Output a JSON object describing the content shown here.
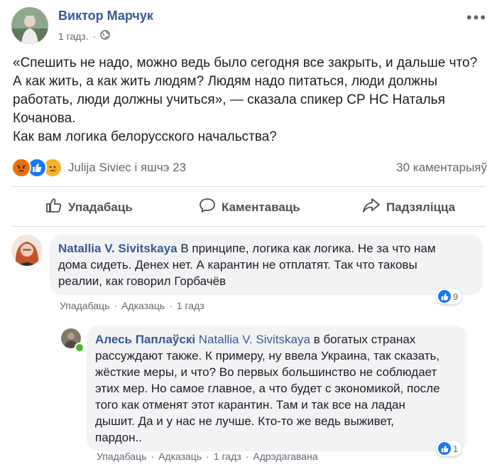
{
  "post": {
    "author": "Виктор Марчук",
    "time": "1 гадз.",
    "lines": [
      "«Спешить не надо, можно ведь было сегодня все закрыть, и дальше что?",
      "А как жить, а как жить людям? Людям надо питаться, люди должны",
      "работать, люди должны учиться», — сказала спикер СР НС Наталья",
      "Кочанова.",
      "Как вам логика белорусского начальства?"
    ]
  },
  "reactions": {
    "names": "Julija Siviec і яшчэ 23",
    "comments_count": "30 каментарыяў",
    "types": [
      "angry-icon",
      "like-icon",
      "sad-icon"
    ]
  },
  "actions": {
    "like": "Упадабаць",
    "comment": "Каментаваць",
    "share": "Падзяліцца"
  },
  "comments": [
    {
      "author": "Natallia V. Sivitskaya",
      "lines": [
        "В принципе, логика как логика. Не за что нам",
        "дома сидеть. Денех нет. А карантин не отплатят. Так что таковы",
        "реалии, как говорил Горбачёв"
      ],
      "like": "Упадабаць",
      "reply": "Адказаць",
      "time": "1 гадз",
      "likes": "9"
    },
    {
      "author": "Алесь Паплаўскі",
      "mention": "Natallia V. Sivitskaya",
      "lines": [
        "в богатых странах",
        "рассуждают также. К примеру, ну ввела Украина, так сказать,",
        "жёсткие меры, и что? Во первых большинство не соблюдает",
        "этих мер. Но самое главное, а что будет с экономикой, после",
        "того как отменят этот карантин. Там и так все на ладан",
        "дышит. Да и у нас не лучше. Кто-то же ведь выживет,",
        "пардон.."
      ],
      "like": "Упадабаць",
      "reply": "Адказаць",
      "time": "1 гадз",
      "edited": "Адрэдагавана",
      "likes": "1"
    }
  ],
  "colors": {
    "link": "#385898",
    "like_blue": "#1877f2",
    "bubble": "#f2f3f5"
  }
}
